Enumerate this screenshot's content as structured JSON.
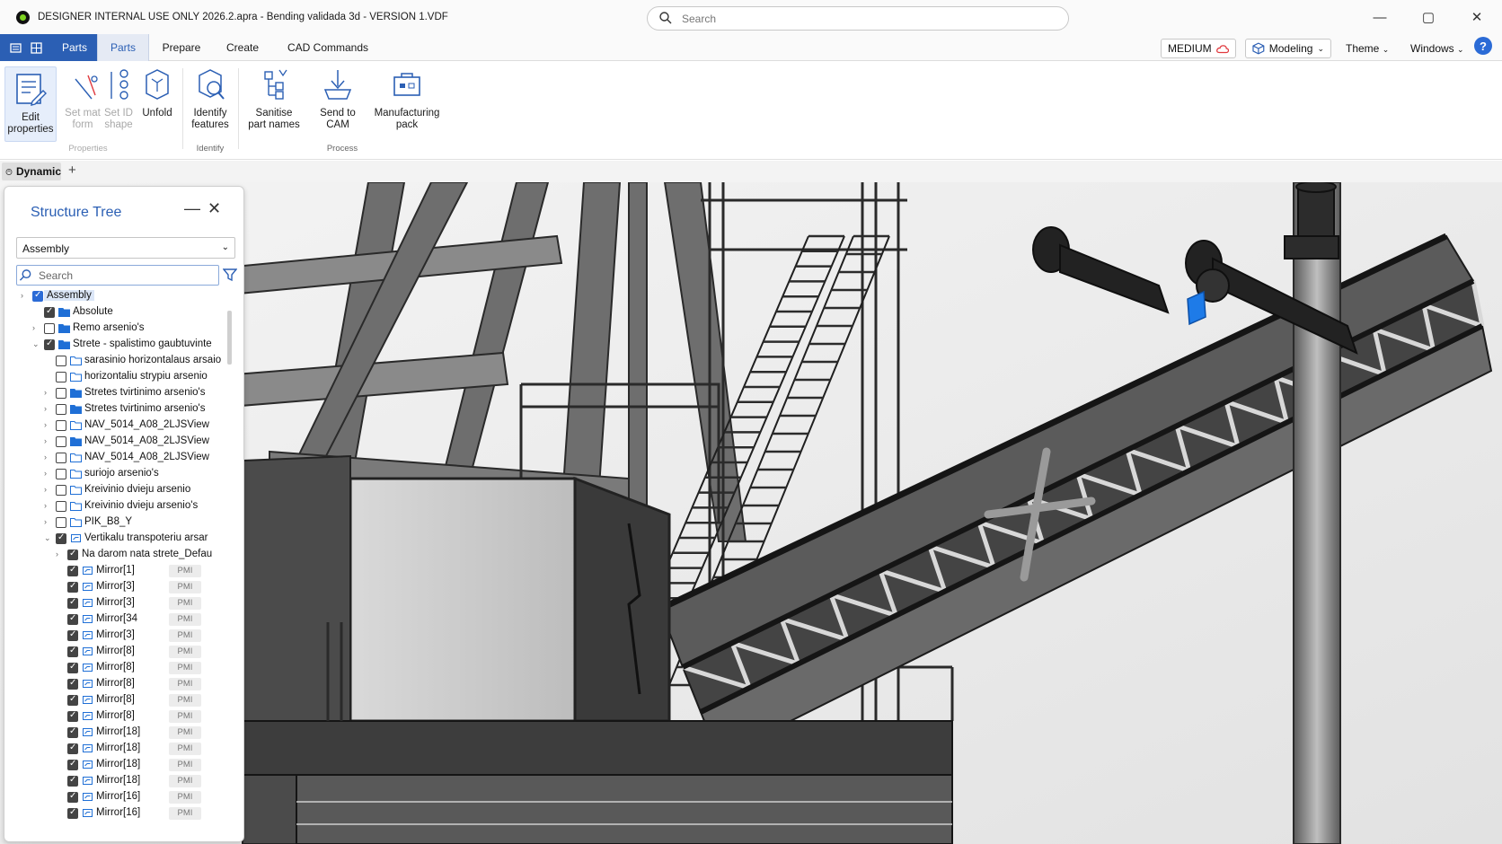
{
  "window": {
    "title": "DESIGNER INTERNAL USE ONLY 2026.2.apra - Bending validada 3d - VERSION 1.VDF",
    "search_placeholder": "Search"
  },
  "tabs": {
    "active_blue": "Parts",
    "items": [
      "Parts",
      "Prepare",
      "Create",
      "CAD Commands"
    ]
  },
  "header_right": {
    "license": "MEDIUM",
    "mode": "Modeling",
    "theme": "Theme",
    "windows": "Windows"
  },
  "ribbon": {
    "buttons": [
      {
        "label_1": "Edit",
        "label_2": "properties",
        "icon": "edit-properties-icon"
      },
      {
        "label_1": "Set mat",
        "label_2": "form",
        "icon": "set-material-icon"
      },
      {
        "label_1": "Set ID",
        "label_2": "shape",
        "icon": "set-id-icon"
      },
      {
        "label_1": "Unfold",
        "label_2": "",
        "icon": "unfold-icon"
      },
      {
        "label_1": "Identify",
        "label_2": "features",
        "icon": "identify-features-icon"
      },
      {
        "label_1": "Sanitise",
        "label_2": "part names",
        "icon": "sanitise-icon"
      },
      {
        "label_1": "Send to",
        "label_2": "CAM",
        "icon": "send-to-cam-icon"
      },
      {
        "label_1": "Manufacturing",
        "label_2": "pack",
        "icon": "manufacturing-pack-icon"
      }
    ],
    "groups": [
      "Properties",
      "Identify",
      "Process"
    ]
  },
  "view_tab": {
    "label": "Dynamic"
  },
  "structure_tree": {
    "title": "Structure Tree",
    "dropdown_value": "Assembly",
    "search_placeholder": "Search",
    "pmi_label": "PMI",
    "rows": [
      {
        "label": "Assembly",
        "level": 0,
        "arrow": "›",
        "checked": "blue",
        "folder": "none",
        "selected": true
      },
      {
        "label": "Absolute",
        "level": 1,
        "arrow": "",
        "checked": "on",
        "folder": "filled"
      },
      {
        "label": "Remo arsenio's",
        "level": 1,
        "arrow": "›",
        "checked": "off",
        "folder": "filled"
      },
      {
        "label": "Strete - spalistimo gaubtuvinte",
        "level": 1,
        "arrow": "⌄",
        "checked": "on",
        "folder": "filled"
      },
      {
        "label": "sarasinio horizontalaus arsaio",
        "level": 2,
        "arrow": "",
        "checked": "off",
        "folder": "outline"
      },
      {
        "label": "horizontaliu strypiu arsenio",
        "level": 2,
        "arrow": "",
        "checked": "off",
        "folder": "outline"
      },
      {
        "label": "Stretes tvirtinimo arsenio's",
        "level": 2,
        "arrow": "›",
        "checked": "off",
        "folder": "filled"
      },
      {
        "label": "Stretes tvirtinimo arsenio's",
        "level": 2,
        "arrow": "›",
        "checked": "off",
        "folder": "filled"
      },
      {
        "label": "NAV_5014_A08_2LJSView",
        "level": 2,
        "arrow": "›",
        "checked": "off",
        "folder": "outline"
      },
      {
        "label": "NAV_5014_A08_2LJSView",
        "level": 2,
        "arrow": "›",
        "checked": "off",
        "folder": "filled"
      },
      {
        "label": "NAV_5014_A08_2LJSView",
        "level": 2,
        "arrow": "›",
        "checked": "off",
        "folder": "outline"
      },
      {
        "label": "suriojo arsenio's",
        "level": 2,
        "arrow": "›",
        "checked": "off",
        "folder": "outline"
      },
      {
        "label": "Kreivinio dvieju arsenio",
        "level": 2,
        "arrow": "›",
        "checked": "off",
        "folder": "outline"
      },
      {
        "label": "Kreivinio dvieju arsenio's",
        "level": 2,
        "arrow": "›",
        "checked": "off",
        "folder": "outline"
      },
      {
        "label": "PIK_B8_Y",
        "level": 2,
        "arrow": "›",
        "checked": "off",
        "folder": "outline"
      },
      {
        "label": "Vertikalu transpoteriu arsar",
        "level": 2,
        "arrow": "⌄",
        "checked": "on",
        "folder": "part"
      },
      {
        "label": "Na darom nata strete_Defau",
        "level": 3,
        "arrow": "›",
        "checked": "on",
        "folder": "none"
      },
      {
        "label": "Mirror[1]",
        "level": 3,
        "arrow": "",
        "checked": "on",
        "folder": "part",
        "pmi": true
      },
      {
        "label": "Mirror[3]",
        "level": 3,
        "arrow": "",
        "checked": "on",
        "folder": "part",
        "pmi": true
      },
      {
        "label": "Mirror[3]",
        "level": 3,
        "arrow": "",
        "checked": "on",
        "folder": "part",
        "pmi": true
      },
      {
        "label": "Mirror[34",
        "level": 3,
        "arrow": "",
        "checked": "on",
        "folder": "part",
        "pmi": true
      },
      {
        "label": "Mirror[3]",
        "level": 3,
        "arrow": "",
        "checked": "on",
        "folder": "part",
        "pmi": true
      },
      {
        "label": "Mirror[8]",
        "level": 3,
        "arrow": "",
        "checked": "on",
        "folder": "part",
        "pmi": true
      },
      {
        "label": "Mirror[8]",
        "level": 3,
        "arrow": "",
        "checked": "on",
        "folder": "part",
        "pmi": true
      },
      {
        "label": "Mirror[8]",
        "level": 3,
        "arrow": "",
        "checked": "on",
        "folder": "part",
        "pmi": true
      },
      {
        "label": "Mirror[8]",
        "level": 3,
        "arrow": "",
        "checked": "on",
        "folder": "part",
        "pmi": true
      },
      {
        "label": "Mirror[8]",
        "level": 3,
        "arrow": "",
        "checked": "on",
        "folder": "part",
        "pmi": true
      },
      {
        "label": "Mirror[18]",
        "level": 3,
        "arrow": "",
        "checked": "on",
        "folder": "part",
        "pmi": true
      },
      {
        "label": "Mirror[18]",
        "level": 3,
        "arrow": "",
        "checked": "on",
        "folder": "part",
        "pmi": true
      },
      {
        "label": "Mirror[18]",
        "level": 3,
        "arrow": "",
        "checked": "on",
        "folder": "part",
        "pmi": true
      },
      {
        "label": "Mirror[18]",
        "level": 3,
        "arrow": "",
        "checked": "on",
        "folder": "part",
        "pmi": true
      },
      {
        "label": "Mirror[16]",
        "level": 3,
        "arrow": "",
        "checked": "on",
        "folder": "part",
        "pmi": true
      },
      {
        "label": "Mirror[16]",
        "level": 3,
        "arrow": "",
        "checked": "on",
        "folder": "part",
        "pmi": true
      }
    ]
  },
  "colors": {
    "accent": "#2b5fb4",
    "folder_blue": "#1f6fd6",
    "cloud_red": "#e0393e",
    "status_green": "#7dd321"
  }
}
